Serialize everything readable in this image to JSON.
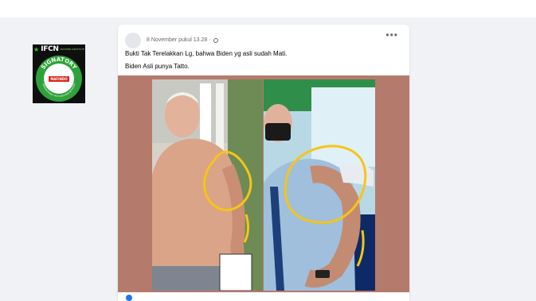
{
  "badge": {
    "brand": "IFCN",
    "brand_sub": "POYNTER INSTITUTE",
    "ring_text": "SIGNATORY",
    "ring_small": "INTERNATIONAL FACT-CHECKING NETWORK",
    "partner": "MAFINDO"
  },
  "post": {
    "timestamp": "8 November pukul 13.28 ·",
    "line1": "Bukti Tak Terelakkan Lg, bahwa Biden yg asli sudah Mati.",
    "line2": "Biden Asli punya Tatto.",
    "more_label": "•••"
  },
  "colors": {
    "media_bg": "#b47a6c",
    "circle_annotation": "#f5c518",
    "ifcn_green": "#2ea23a"
  }
}
